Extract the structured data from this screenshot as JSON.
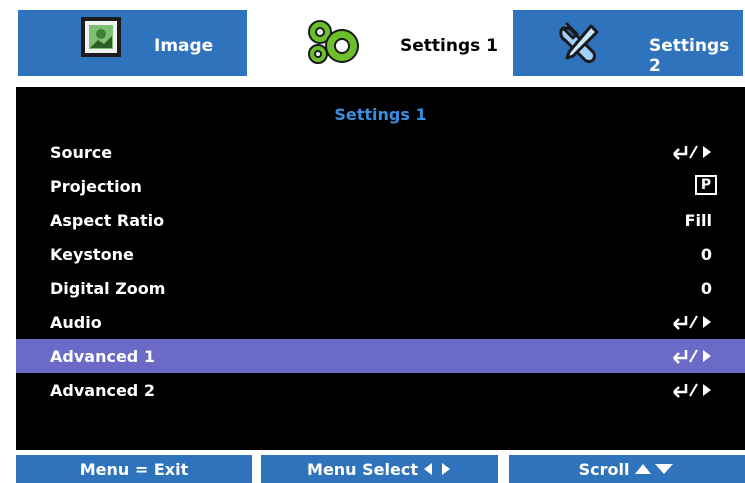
{
  "tabs": [
    {
      "label": "Image",
      "icon": "image-icon",
      "active": false
    },
    {
      "label": "Settings 1",
      "icon": "gears-icon",
      "active": true
    },
    {
      "label": "Settings 2",
      "icon": "tools-icon",
      "active": false
    }
  ],
  "panel": {
    "title": "Settings 1"
  },
  "menu": [
    {
      "label": "Source",
      "value_icon": "enter-right-icon"
    },
    {
      "label": "Projection",
      "value": "P"
    },
    {
      "label": "Aspect Ratio",
      "value": "Fill"
    },
    {
      "label": "Keystone",
      "value": "0"
    },
    {
      "label": "Digital Zoom",
      "value": "0"
    },
    {
      "label": "Audio",
      "value_icon": "enter-right-icon"
    },
    {
      "label": "Advanced 1",
      "value_icon": "enter-right-icon",
      "selected": true
    },
    {
      "label": "Advanced 2",
      "value_icon": "enter-right-icon"
    }
  ],
  "footer": {
    "exit_label": "Menu = Exit",
    "select_label": "Menu Select",
    "scroll_label": "Scroll"
  },
  "colors": {
    "tab_blue": "#2f73bd",
    "panel_black": "#000000",
    "title_blue": "#3b8fe0",
    "selected_row": "#6b6ac6",
    "white": "#ffffff"
  }
}
